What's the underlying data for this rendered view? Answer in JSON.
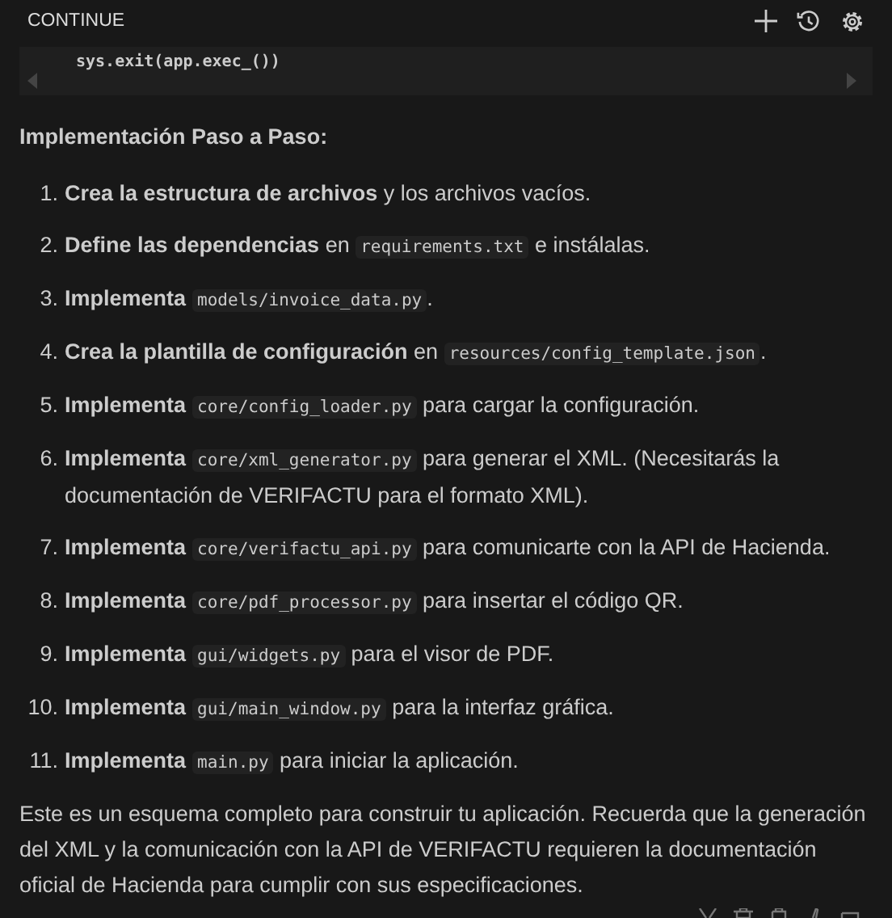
{
  "header": {
    "title": "CONTINUE"
  },
  "code_block": {
    "line": "sys.exit(app.exec_())"
  },
  "heading": "Implementación Paso a Paso:",
  "steps": [
    {
      "number": "1.",
      "parts": [
        {
          "kind": "bold",
          "text": "Crea la estructura de archivos"
        },
        {
          "kind": "text",
          "text": " y los archivos vacíos."
        }
      ]
    },
    {
      "number": "2.",
      "parts": [
        {
          "kind": "bold",
          "text": "Define las dependencias"
        },
        {
          "kind": "text",
          "text": " en "
        },
        {
          "kind": "code",
          "text": "requirements.txt"
        },
        {
          "kind": "text",
          "text": " e instálalas."
        }
      ]
    },
    {
      "number": "3.",
      "parts": [
        {
          "kind": "bold",
          "text": "Implementa"
        },
        {
          "kind": "code",
          "text": "models/invoice_data.py"
        },
        {
          "kind": "text",
          "text": "."
        }
      ]
    },
    {
      "number": "4.",
      "parts": [
        {
          "kind": "bold",
          "text": "Crea la plantilla de configuración"
        },
        {
          "kind": "text",
          "text": " en "
        },
        {
          "kind": "code",
          "text": "resources/config_template.json"
        },
        {
          "kind": "text",
          "text": "."
        }
      ]
    },
    {
      "number": "5.",
      "parts": [
        {
          "kind": "bold",
          "text": "Implementa"
        },
        {
          "kind": "code",
          "text": "core/config_loader.py"
        },
        {
          "kind": "text",
          "text": " para cargar la configuración."
        }
      ]
    },
    {
      "number": "6.",
      "parts": [
        {
          "kind": "bold",
          "text": "Implementa"
        },
        {
          "kind": "code",
          "text": "core/xml_generator.py"
        },
        {
          "kind": "text",
          "text": " para generar el XML. (Necesitarás la documentación de VERIFACTU para el formato XML)."
        }
      ]
    },
    {
      "number": "7.",
      "parts": [
        {
          "kind": "bold",
          "text": "Implementa"
        },
        {
          "kind": "code",
          "text": "core/verifactu_api.py"
        },
        {
          "kind": "text",
          "text": " para comunicarte con la API de Hacienda."
        }
      ]
    },
    {
      "number": "8.",
      "parts": [
        {
          "kind": "bold",
          "text": "Implementa"
        },
        {
          "kind": "code",
          "text": "core/pdf_processor.py"
        },
        {
          "kind": "text",
          "text": " para insertar el código QR."
        }
      ]
    },
    {
      "number": "9.",
      "parts": [
        {
          "kind": "bold",
          "text": "Implementa"
        },
        {
          "kind": "code",
          "text": "gui/widgets.py"
        },
        {
          "kind": "text",
          "text": " para el visor de PDF."
        }
      ]
    },
    {
      "number": "10.",
      "parts": [
        {
          "kind": "bold",
          "text": "Implementa"
        },
        {
          "kind": "code",
          "text": "gui/main_window.py"
        },
        {
          "kind": "text",
          "text": " para la interfaz gráfica."
        }
      ]
    },
    {
      "number": "11.",
      "parts": [
        {
          "kind": "bold",
          "text": "Implementa"
        },
        {
          "kind": "code",
          "text": "main.py"
        },
        {
          "kind": "text",
          "text": " para iniciar la aplicación."
        }
      ]
    }
  ],
  "summary": "Este es un esquema completo para construir tu aplicación. Recuerda que la generación del XML y la comunicación con la API de VERIFACTU requieren la documentación oficial de Hacienda para cumplir con sus especificaciones."
}
